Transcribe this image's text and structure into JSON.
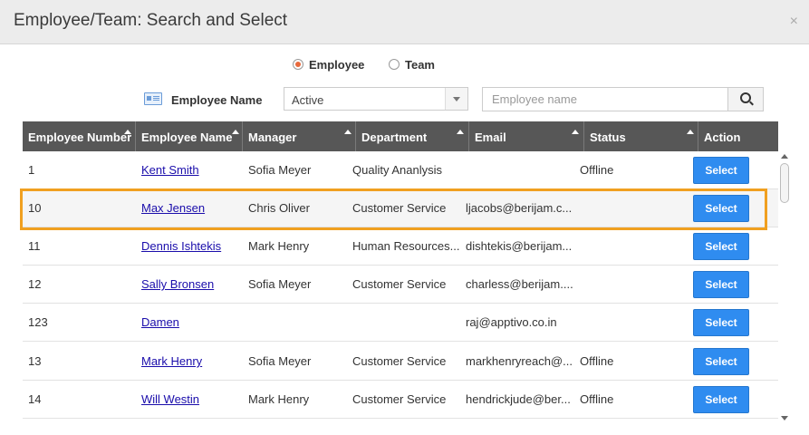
{
  "dialog": {
    "title": "Employee/Team: Search and Select",
    "close_icon": "×"
  },
  "mode": {
    "options": [
      "Employee",
      "Team"
    ],
    "selected": "Employee"
  },
  "filter": {
    "label": "Employee Name",
    "status_value": "Active",
    "search_placeholder": "Employee name",
    "search_value": ""
  },
  "table": {
    "columns": [
      "Employee Number",
      "Employee Name",
      "Manager",
      "Department",
      "Email",
      "Status",
      "Action"
    ],
    "rows": [
      {
        "number": "1",
        "name": "Kent Smith",
        "manager": "Sofia Meyer",
        "department": "Quality Ananlysis",
        "email": "",
        "status": "Offline",
        "action": "Select"
      },
      {
        "number": "10",
        "name": "Max Jensen",
        "manager": "Chris Oliver",
        "department": "Customer Service",
        "email": "ljacobs@berijam.c...",
        "status": "",
        "action": "Select"
      },
      {
        "number": "11",
        "name": "Dennis Ishtekis",
        "manager": "Mark Henry",
        "department": "Human Resources...",
        "email": "dishtekis@berijam...",
        "status": "",
        "action": "Select"
      },
      {
        "number": "12",
        "name": "Sally Bronsen",
        "manager": "Sofia Meyer",
        "department": "Customer Service",
        "email": "charless@berijam....",
        "status": "",
        "action": "Select"
      },
      {
        "number": "123",
        "name": "Damen",
        "manager": "",
        "department": "",
        "email": "raj@apptivo.co.in",
        "status": "",
        "action": "Select"
      },
      {
        "number": "13",
        "name": "Mark Henry",
        "manager": "Sofia Meyer",
        "department": "Customer Service",
        "email": "markhenryreach@...",
        "status": "Offline",
        "action": "Select"
      },
      {
        "number": "14",
        "name": "Will Westin",
        "manager": "Mark Henry",
        "department": "Customer Service",
        "email": "hendrickjude@ber...",
        "status": "Offline",
        "action": "Select"
      }
    ],
    "highlighted_row": "10"
  },
  "colors": {
    "header_bg": "#575757",
    "select_button": "#2f8cf0",
    "highlight": "#f0a020",
    "radio_selected": "#e8693c"
  }
}
